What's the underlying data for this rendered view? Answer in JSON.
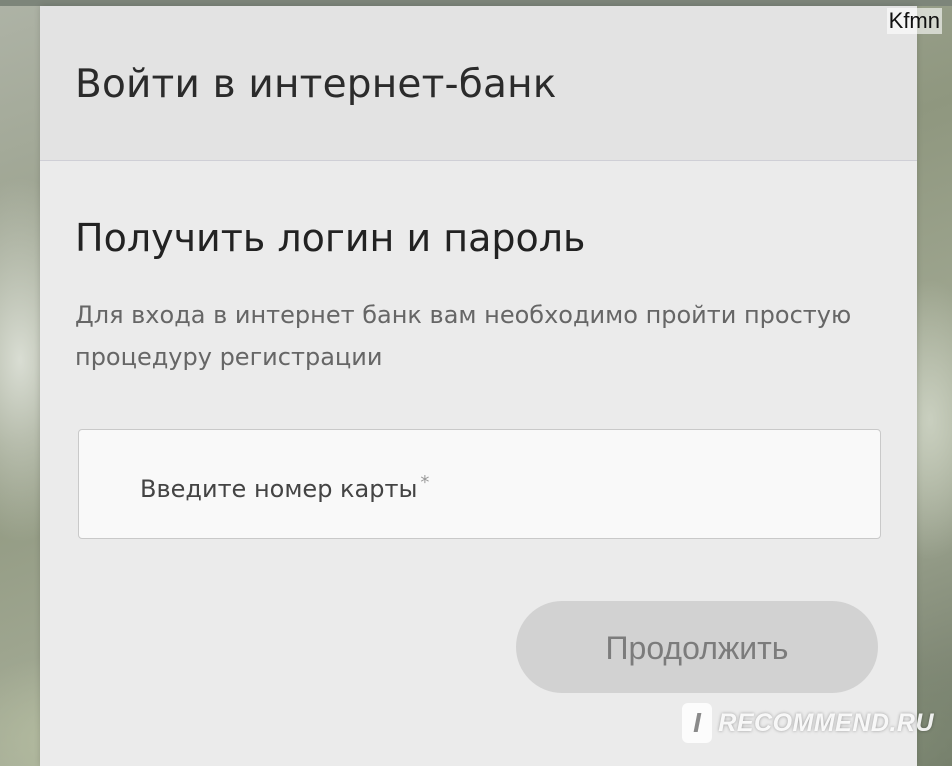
{
  "dialog": {
    "header_title": "Войти в интернет-банк",
    "section_title": "Получить логин и пароль",
    "description": "Для входа в интернет банк вам необходимо пройти простую процедуру регистрации",
    "card_field": {
      "placeholder": "Введите номер карты",
      "required_mark": "*"
    },
    "continue_button": "Продолжить"
  },
  "corner_tag": "Kfmn",
  "watermark": {
    "icon_letter": "I",
    "text": "RECOMMEND.RU"
  },
  "colors": {
    "dialog_background": "#ebebeb",
    "header_background": "#e3e3e3",
    "button_disabled": "#d2d2d2",
    "button_text": "#7c7c7c"
  }
}
